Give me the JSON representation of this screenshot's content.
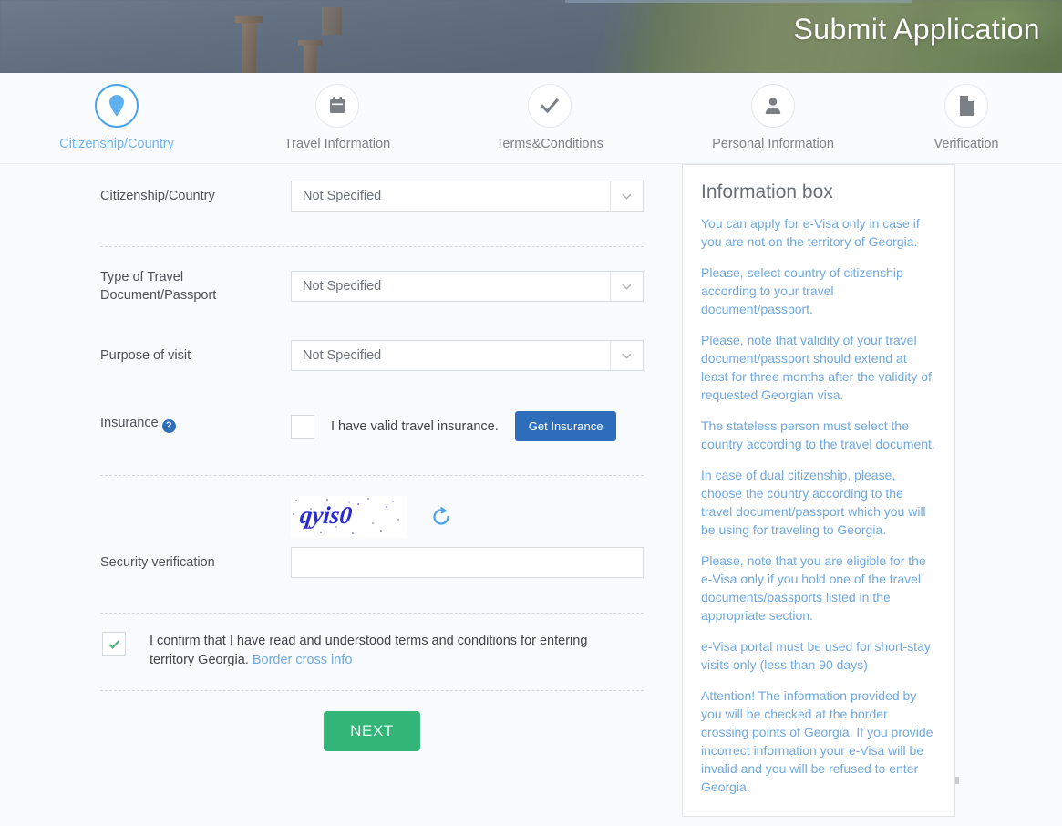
{
  "hero": {
    "title": "Submit Application"
  },
  "stepper": {
    "active_color": "#6fb2ec",
    "inactive_color": "#7d8288",
    "steps": [
      {
        "label": "Citizenship/Country",
        "icon": "map-pin-icon",
        "active": true
      },
      {
        "label": "Travel Information",
        "icon": "calendar-icon",
        "active": false
      },
      {
        "label": "Terms&Conditions",
        "icon": "check-icon",
        "active": false
      },
      {
        "label": "Personal Information",
        "icon": "person-icon",
        "active": false
      },
      {
        "label": "Verification",
        "icon": "document-icon",
        "active": false
      }
    ]
  },
  "form": {
    "citizenship": {
      "label": "Citizenship/Country",
      "value": "Not Specified",
      "arrow_icon": "chevron-down-icon"
    },
    "travel_document": {
      "label": "Type of Travel Document/Passport",
      "label_line1": "Type of Travel",
      "label_line2": "Document/Passport",
      "value": "Not Specified",
      "arrow_icon": "chevron-down-icon"
    },
    "purpose": {
      "label": "Purpose of visit",
      "value": "Not Specified",
      "arrow_icon": "chevron-down-icon"
    },
    "insurance": {
      "label": "Insurance",
      "help_icon": "help-circle-icon",
      "checkbox_checked": false,
      "checkbox_label": "I have valid travel insurance.",
      "button_label": "Get Insurance",
      "button_color": "#2e6dba"
    },
    "captcha": {
      "text": "qyis0",
      "refresh_icon": "refresh-icon",
      "color": "#2b2bd6"
    },
    "security": {
      "label": "Security verification",
      "value": "",
      "placeholder": ""
    },
    "confirm": {
      "checked": true,
      "check_color": "#4cb07c",
      "text": "I confirm that I have read and understood terms and conditions for entering territory Georgia.",
      "link_label": "Border cross info",
      "link_color": "#6fa8dc"
    },
    "next_button": {
      "label": "NEXT",
      "color": "#33b578"
    }
  },
  "info_box": {
    "title": "Information box",
    "text_color": "#6fa8e0",
    "paragraphs": [
      "You can apply for e-Visa only in case if you are not on the territory of Georgia.",
      "Please, select country of citizenship according to your travel document/passport.",
      "Please, note that validity of your travel document/passport should extend at least for three months after the validity of requested Georgian visa.",
      "The stateless person must select the country according to the travel document.",
      "In case of dual citizenship, please, choose the country according to the travel document/passport which you will be using for traveling to Georgia.",
      "Please, note that you are eligible for the e-Visa only if you hold one of the travel documents/passports listed in the appropriate section.",
      "e-Visa portal must be used for short-stay visits only (less than 90 days)",
      "Attention! The information provided by you will be checked at the border crossing points of Georgia. If you provide incorrect information your e-Visa will be invalid and you will be refused to enter Georgia."
    ]
  }
}
